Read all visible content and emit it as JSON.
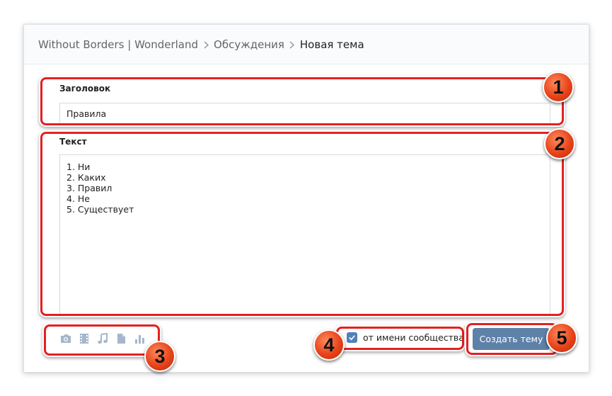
{
  "breadcrumb": {
    "group": "Without Borders | Wonderland",
    "section": "Обсуждения",
    "current": "Новая тема"
  },
  "form": {
    "title_label": "Заголовок",
    "title_value": "Правила",
    "text_label": "Текст",
    "text_lines": [
      "1. Ни",
      "2. Каких",
      "3. Правил",
      "4. Не",
      "5. Существует"
    ]
  },
  "attachments": {
    "icons": [
      "camera-icon",
      "video-icon",
      "music-note-icon",
      "document-icon",
      "poll-icon"
    ]
  },
  "community_checkbox": {
    "label": "от имени сообщества",
    "checked": true
  },
  "submit_label": "Создать тему",
  "annotations": [
    "1",
    "2",
    "3",
    "4",
    "5"
  ],
  "colors": {
    "accent": "#5181b8",
    "button": "#5e81a8",
    "highlight": "#e52020",
    "icon": "#a5b7cc"
  }
}
